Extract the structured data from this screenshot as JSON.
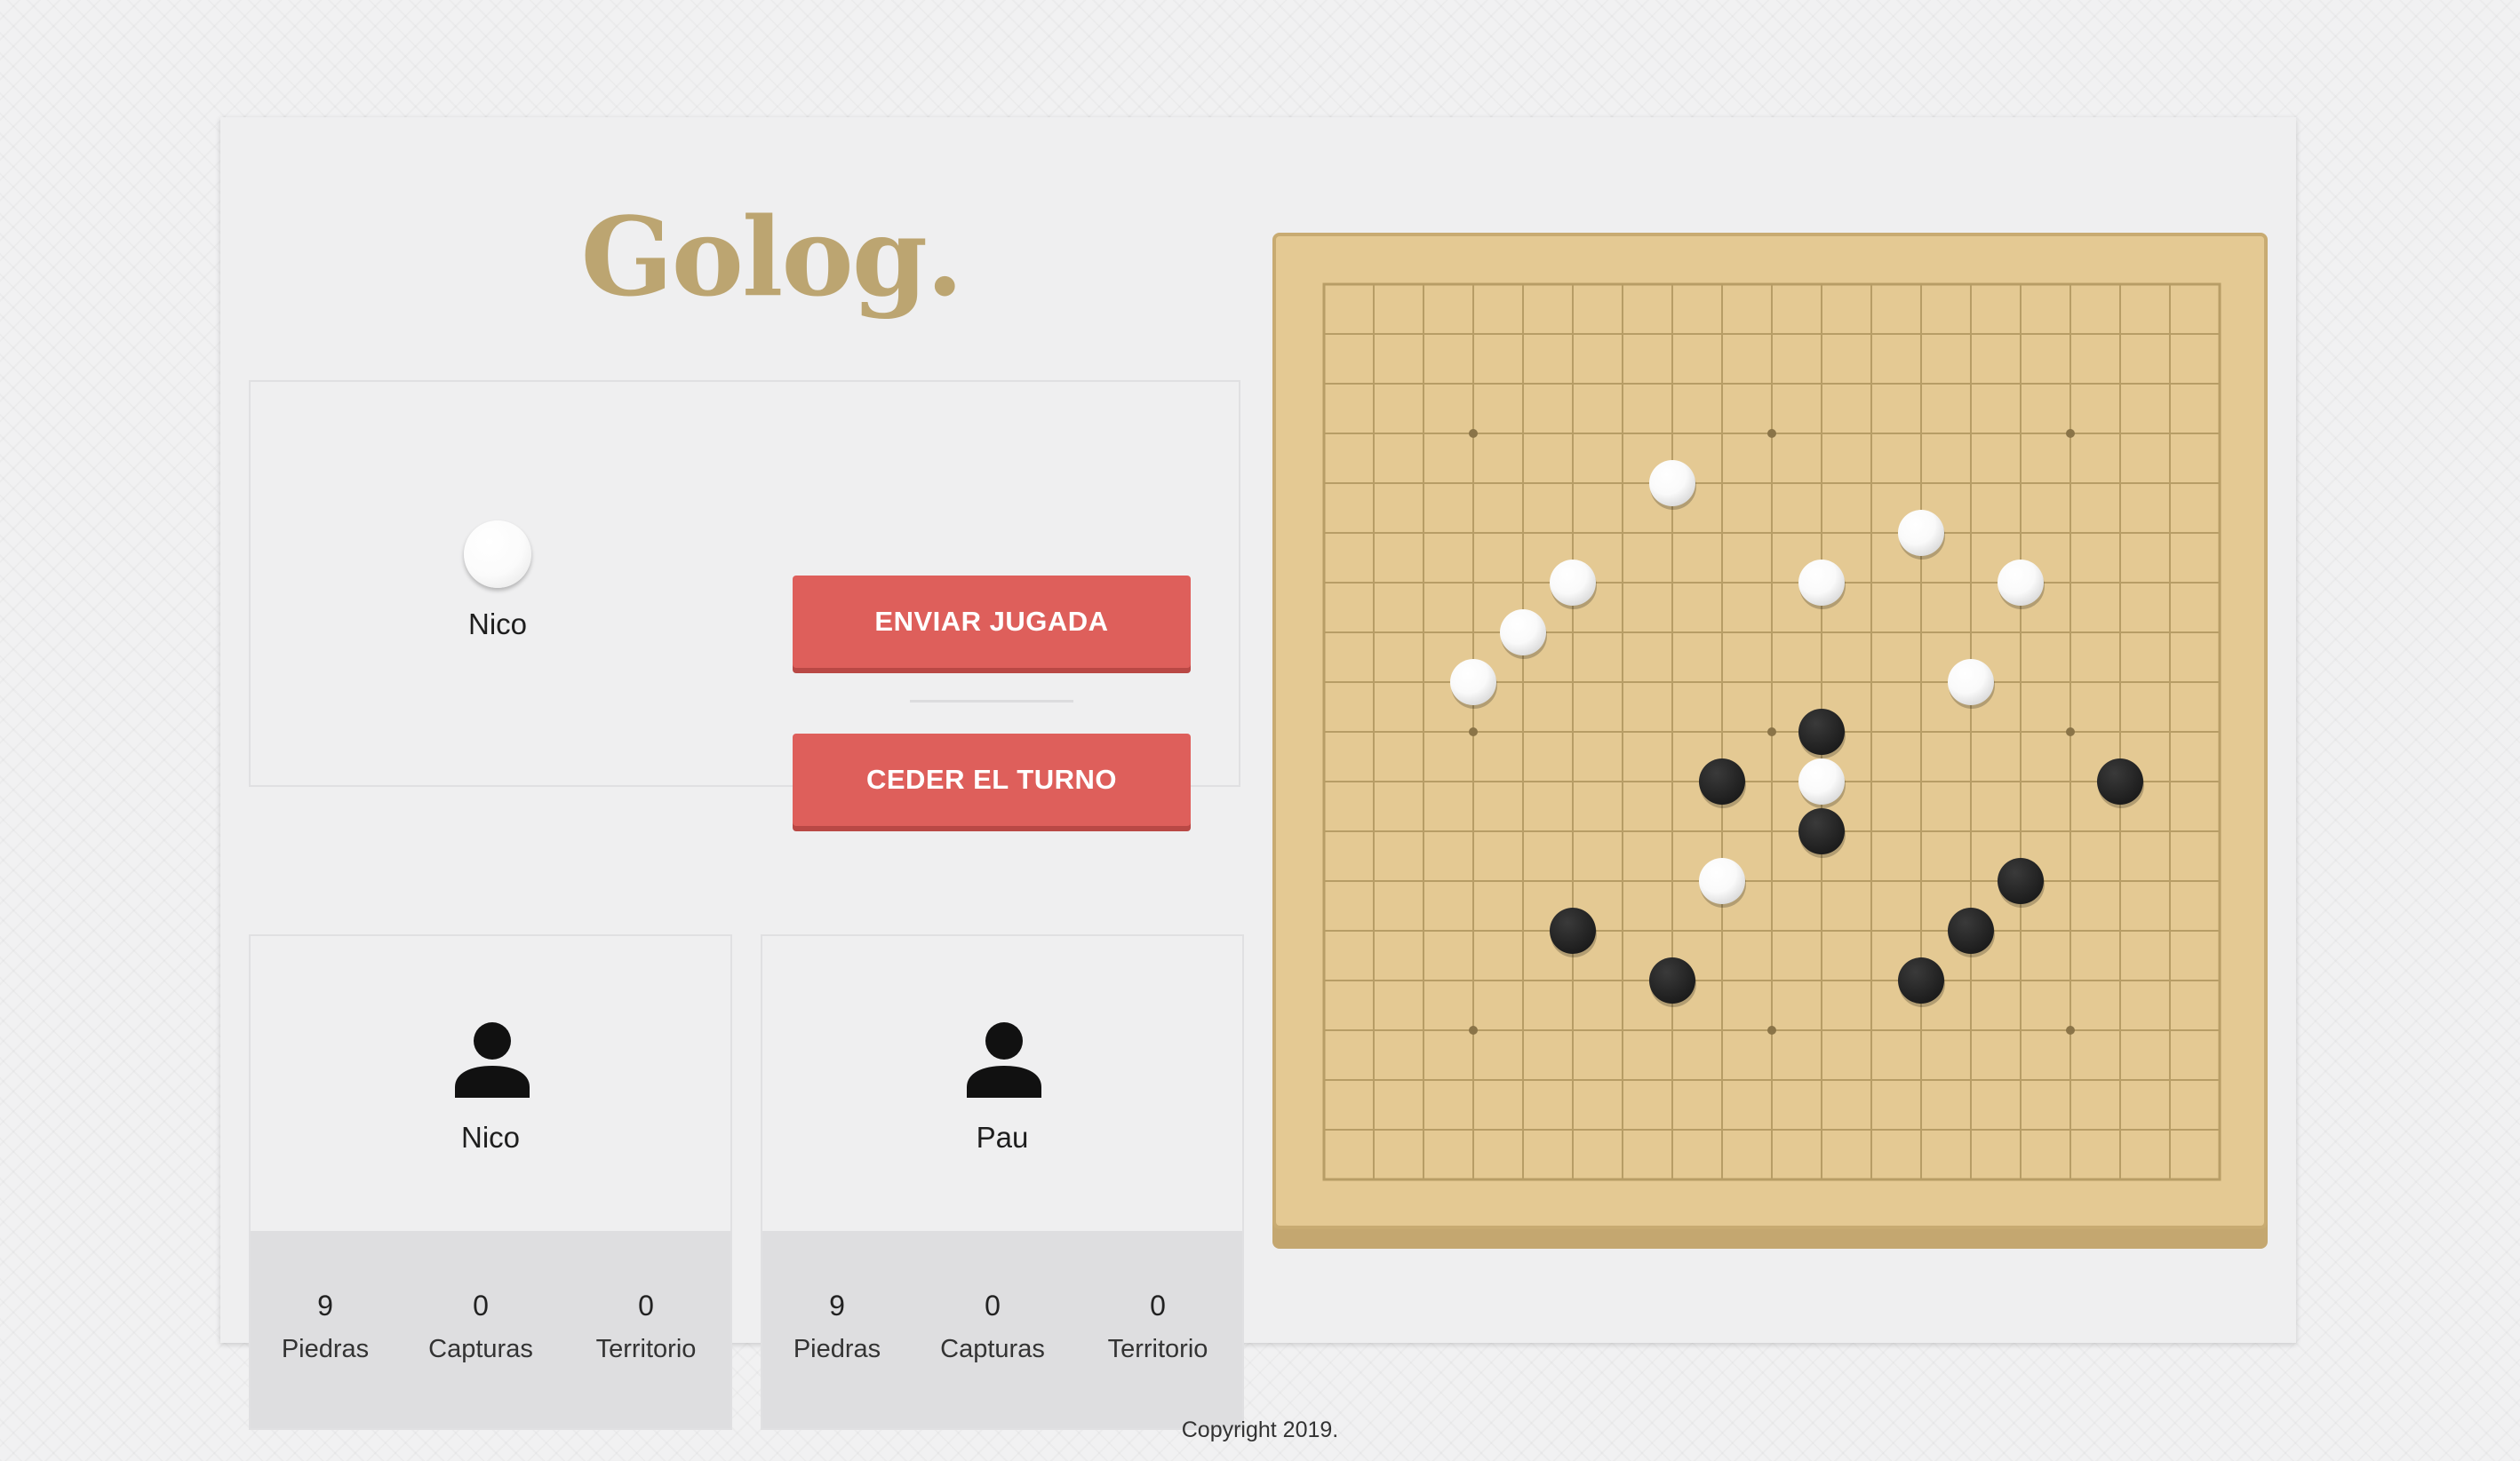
{
  "app": {
    "logo": "Golog."
  },
  "turn": {
    "current_player": "Nico",
    "current_stone_color": "white"
  },
  "actions": {
    "send_move": "ENVIAR JUGADA",
    "pass_turn": "CEDER EL TURNO"
  },
  "players": [
    {
      "name": "Nico",
      "stats": [
        {
          "value": "9",
          "label": "Piedras"
        },
        {
          "value": "0",
          "label": "Capturas"
        },
        {
          "value": "0",
          "label": "Territorio"
        }
      ]
    },
    {
      "name": "Pau",
      "stats": [
        {
          "value": "9",
          "label": "Piedras"
        },
        {
          "value": "0",
          "label": "Capturas"
        },
        {
          "value": "0",
          "label": "Territorio"
        }
      ]
    }
  ],
  "board": {
    "size": 19,
    "hoshi": [
      [
        3,
        3
      ],
      [
        9,
        3
      ],
      [
        15,
        3
      ],
      [
        3,
        9
      ],
      [
        9,
        9
      ],
      [
        15,
        9
      ],
      [
        3,
        15
      ],
      [
        9,
        15
      ],
      [
        15,
        15
      ]
    ],
    "white_stones": [
      [
        7,
        4
      ],
      [
        12,
        5
      ],
      [
        5,
        6
      ],
      [
        10,
        6
      ],
      [
        14,
        6
      ],
      [
        4,
        7
      ],
      [
        3,
        8
      ],
      [
        13,
        8
      ],
      [
        10,
        10
      ],
      [
        8,
        12
      ]
    ],
    "black_stones": [
      [
        10,
        9
      ],
      [
        8,
        10
      ],
      [
        16,
        10
      ],
      [
        10,
        11
      ],
      [
        14,
        12
      ],
      [
        5,
        13
      ],
      [
        13,
        13
      ],
      [
        7,
        14
      ],
      [
        12,
        14
      ]
    ]
  },
  "colors": {
    "accent": "#de5f5b",
    "logo": "#bca571",
    "board_wood": "#e4c993",
    "grid_line": "#b79d66",
    "stone_black": "#1b1b1b",
    "stone_white": "#ffffff"
  },
  "icons": {
    "player_avatar": "user-icon"
  },
  "footer": {
    "copyright": "Copyright 2019."
  }
}
